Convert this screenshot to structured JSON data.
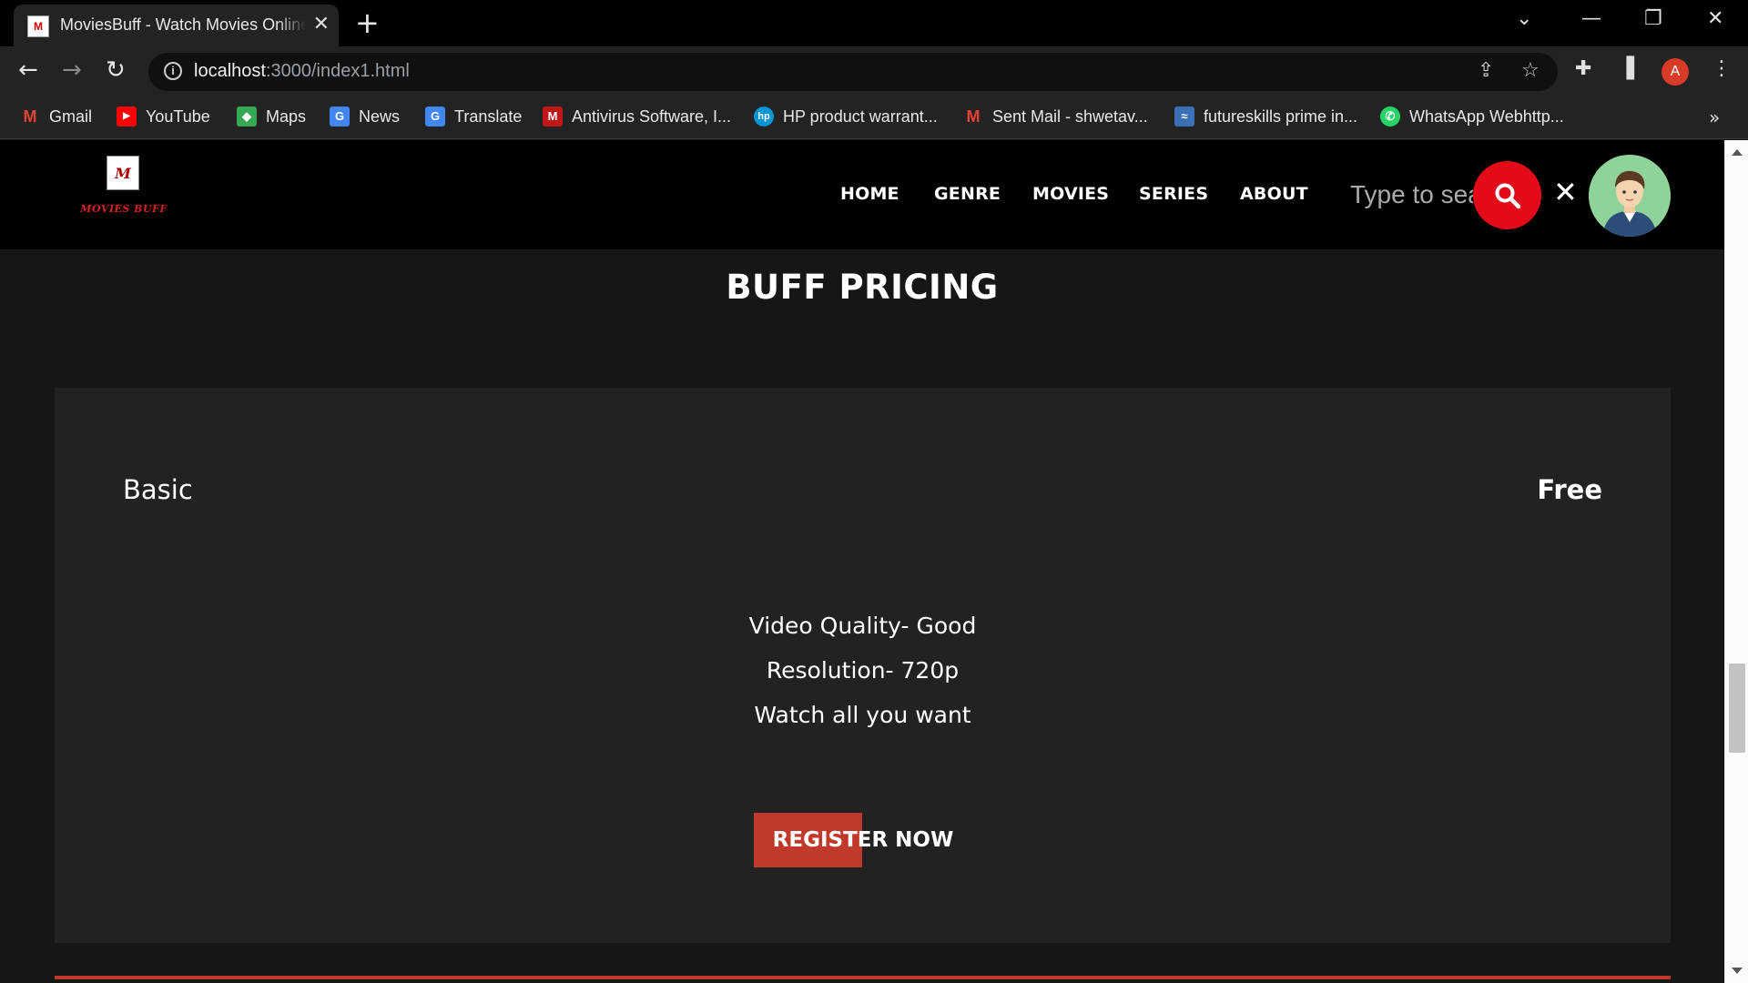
{
  "browser": {
    "tab_title": "MoviesBuff - Watch Movies Online",
    "url_host": "localhost",
    "url_path": ":3000/index1.html",
    "profile_initial": "A",
    "bookmarks": [
      {
        "label": "Gmail",
        "icon": "gmail-icon",
        "glyph": "M",
        "color": "#ea4335"
      },
      {
        "label": "YouTube",
        "icon": "youtube-icon",
        "glyph": "▶",
        "color": "#ff0000"
      },
      {
        "label": "Maps",
        "icon": "maps-icon",
        "glyph": "◆",
        "color": "#34a853"
      },
      {
        "label": "News",
        "icon": "news-icon",
        "glyph": "G",
        "color": "#4285f4"
      },
      {
        "label": "Translate",
        "icon": "translate-icon",
        "glyph": "G",
        "color": "#4285f4"
      },
      {
        "label": "Antivirus Software, I...",
        "icon": "mcafee-icon",
        "glyph": "M",
        "color": "#c01818"
      },
      {
        "label": "HP product warrant...",
        "icon": "hp-icon",
        "glyph": "hp",
        "color": "#0096d6"
      },
      {
        "label": "Sent Mail - shwetav...",
        "icon": "gmail-icon",
        "glyph": "M",
        "color": "#ea4335"
      },
      {
        "label": "futureskills prime in...",
        "icon": "futureskills-icon",
        "glyph": "≈",
        "color": "#3b6fb6"
      },
      {
        "label": "WhatsApp Webhttp...",
        "icon": "whatsapp-icon",
        "glyph": "✆",
        "color": "#25d366"
      }
    ]
  },
  "site": {
    "logo_text": "MOVIES BUFF",
    "nav": [
      "HOME",
      "GENRE",
      "MOVIES",
      "SERIES",
      "ABOUT"
    ],
    "search_placeholder": "Type to search",
    "section_title": "BUFF PRICING",
    "plan": {
      "name": "Basic",
      "price": "Free",
      "features": [
        "Video Quality- Good",
        "Resolution- 720p",
        "Watch all you want"
      ],
      "cta": "REGISTER NOW"
    }
  },
  "colors": {
    "accent_red": "#c0392b",
    "search_red": "#e40a19",
    "card_bg": "#222222",
    "page_bg": "#161616"
  }
}
